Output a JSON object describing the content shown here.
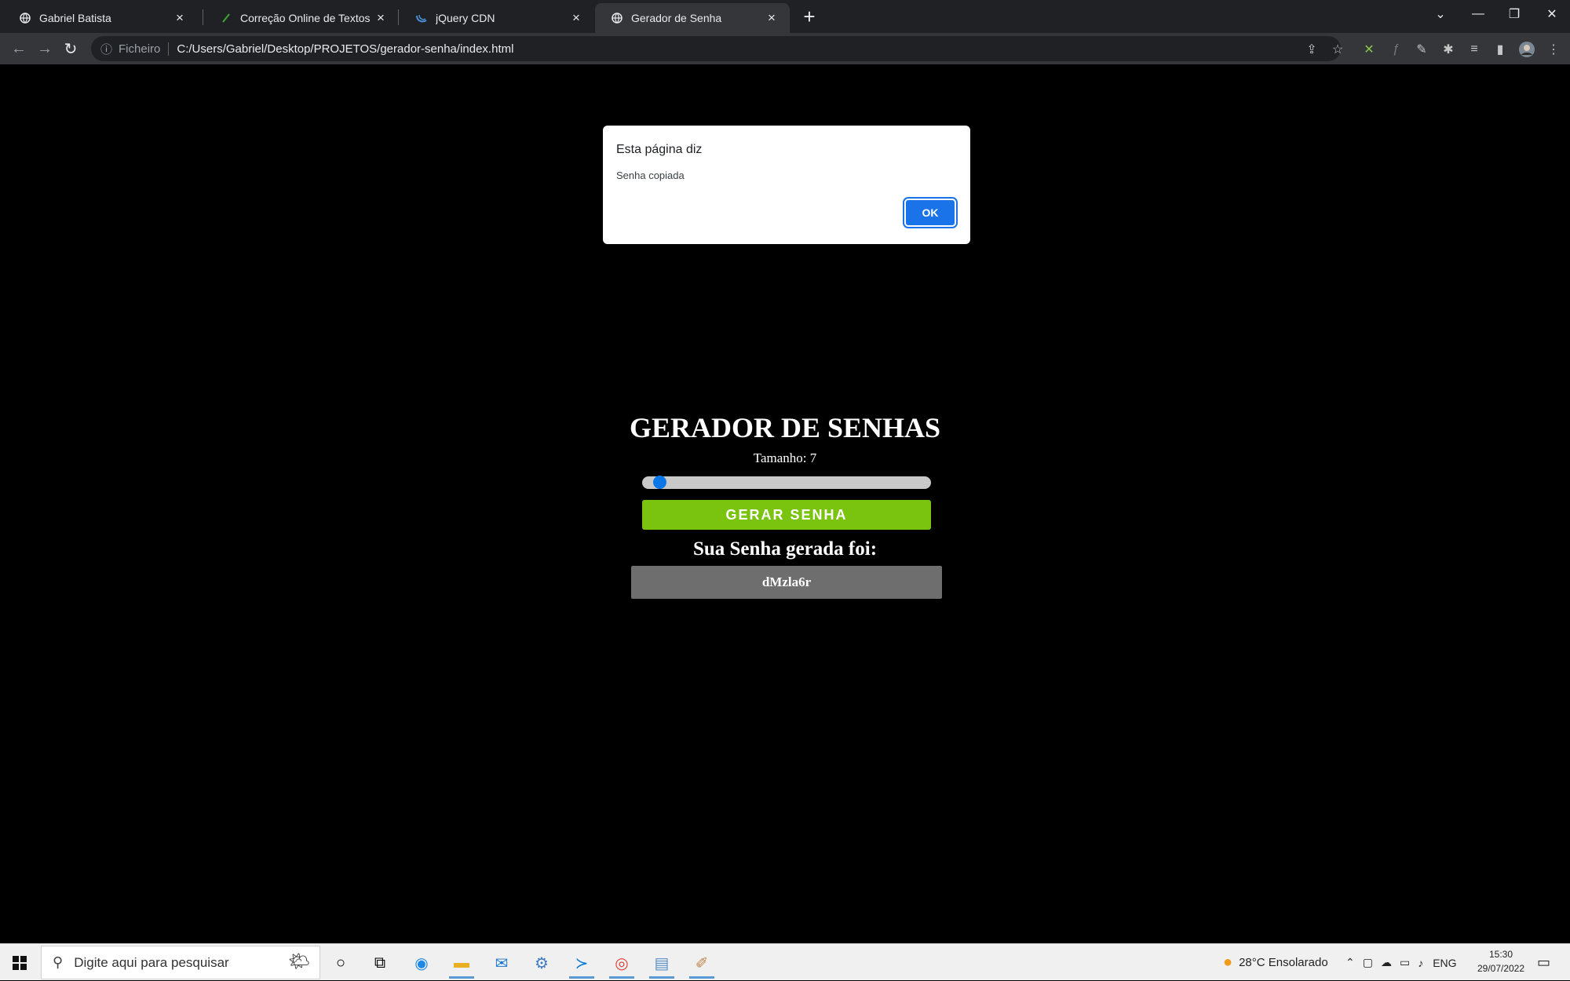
{
  "browser": {
    "tabs": [
      {
        "title": "Gabriel Batista",
        "icon": "globe-icon",
        "active": false
      },
      {
        "title": "Correção Online de Textos",
        "icon": "pen-icon",
        "active": false
      },
      {
        "title": "jQuery CDN",
        "icon": "jquery-icon",
        "active": false
      },
      {
        "title": "Gerador de Senha",
        "icon": "globe-icon",
        "active": true
      }
    ],
    "address": {
      "scheme_label": "Ficheiro",
      "url": "C:/Users/Gabriel/Desktop/PROJETOS/gerador-senha/index.html"
    }
  },
  "app": {
    "title": "GERADOR DE SENHAS",
    "size_label": "Tamanho: 7",
    "slider": {
      "value": 7,
      "min": 6,
      "max": 32
    },
    "generate_button": "GERAR SENHA",
    "result_label": "Sua Senha gerada foi:",
    "password": "dMzla6r"
  },
  "dialog": {
    "title": "Esta página diz",
    "message": "Senha copiada",
    "ok_label": "OK"
  },
  "taskbar": {
    "search_placeholder": "Digite aqui para pesquisar",
    "weather": "28°C  Ensolarado",
    "language": "ENG",
    "time": "15:30",
    "date": "29/07/2022"
  },
  "colors": {
    "accent_green": "#7ac30f",
    "dialog_button": "#1a73e8",
    "slider_thumb": "#0a76e8"
  }
}
